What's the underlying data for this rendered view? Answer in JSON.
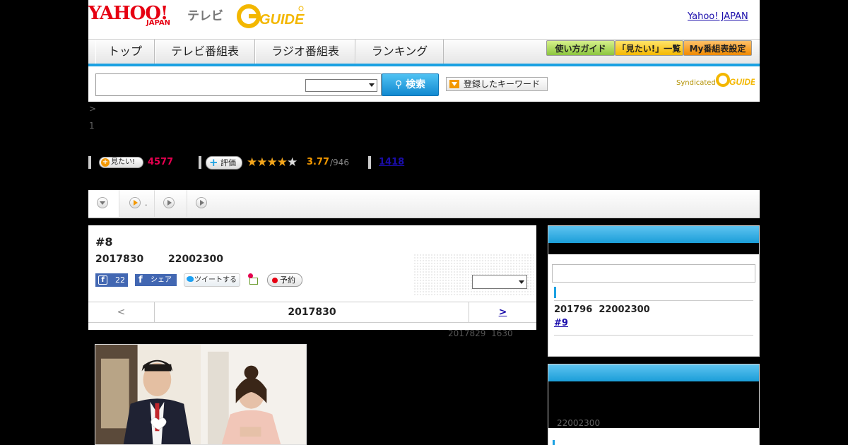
{
  "header": {
    "logo_yahoo": "YAHOO!",
    "logo_japan": "JAPAN",
    "logo_tv": "テレビ",
    "logo_gguide": "G-GUIDE",
    "yahoo_japan_link": "Yahoo! JAPAN"
  },
  "nav": {
    "tabs": [
      "トップ",
      "テレビ番組表",
      "ラジオ番組表",
      "ランキング"
    ],
    "utility": [
      "使い方ガイド",
      "「見たい!」一覧",
      "My番組表設定"
    ]
  },
  "search": {
    "button_label": "検索",
    "keyword_button": "登録したキーワード",
    "syndicated": "Syndicated"
  },
  "breadcrumb": {
    "line1": ">",
    "line2": "1"
  },
  "stats": {
    "mitai_label": "見たい!",
    "mitai_count": "4577",
    "hyouka_label": "評価",
    "rating": "3.77",
    "rating_count": "/946",
    "review_count": "1418",
    "rating_value": 3.77
  },
  "subtabs": {
    "second_label": "."
  },
  "episode": {
    "title": "#8",
    "date": "2017830",
    "time": "22002300",
    "fb_like_count": "22",
    "fb_share": "シェア",
    "tweet": "ツイートする",
    "reserve": "予約",
    "pager_prev": "<",
    "pager_date": "2017830",
    "pager_next": ">",
    "updated_date": "2017829",
    "updated_time": "1630"
  },
  "sidebar": {
    "next_date": "201796",
    "next_time": "22002300",
    "next_episode": "#9",
    "block2_time": "22002300"
  },
  "colors": {
    "accent_blue": "#1ba1e2",
    "yahoo_red": "#e60012",
    "mitai_pink": "#e5004f",
    "rating_orange": "#f39800"
  }
}
